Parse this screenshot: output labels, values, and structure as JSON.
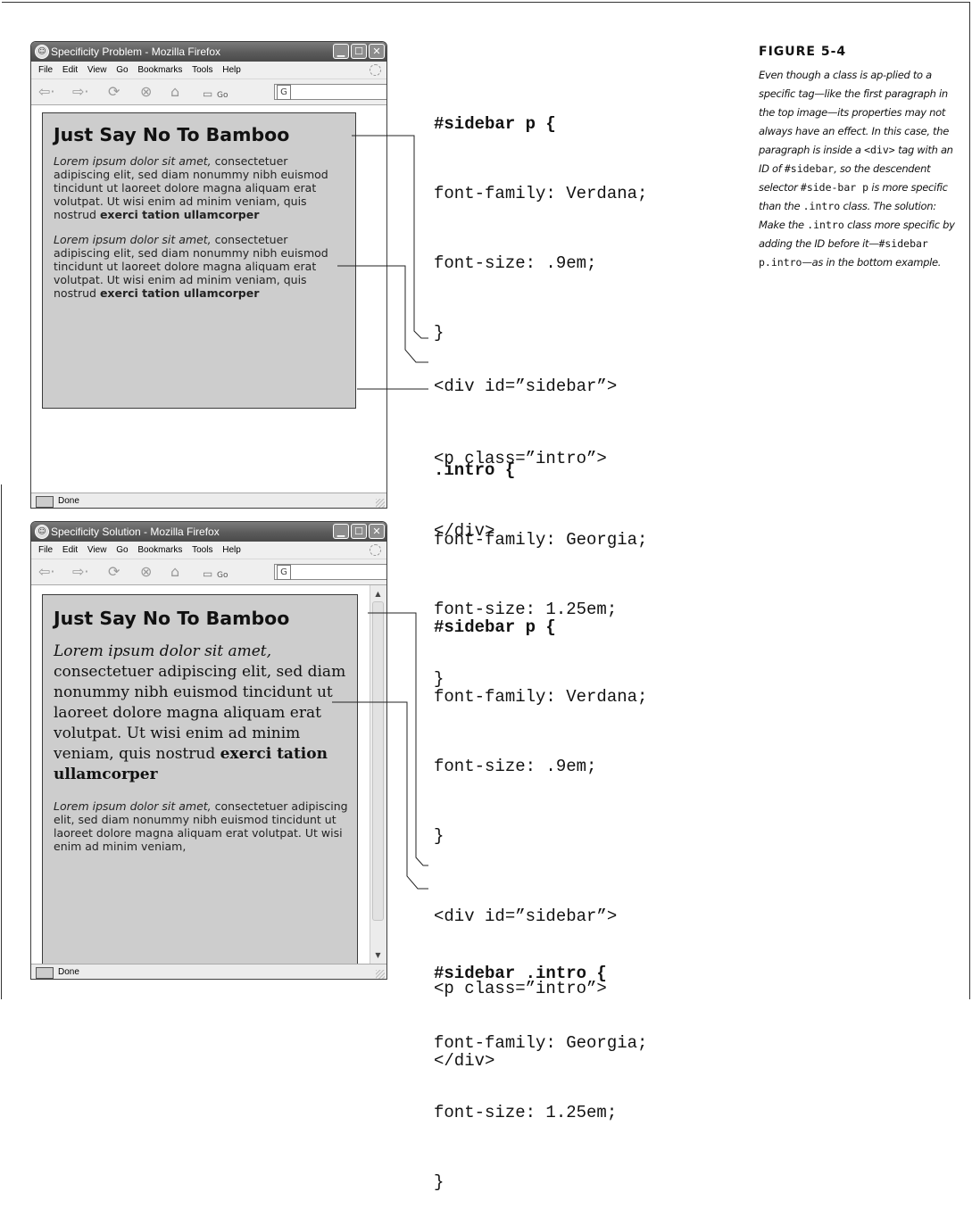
{
  "figure": {
    "label": "FIGURE 5-4",
    "caption": [
      {
        "t": "Even though a class is ap-plied to a specific tag—like the first paragraph in the top image—its properties may not always have an effect. In this case, the paragraph is inside a ",
        "code": false
      },
      {
        "t": "<div>",
        "code": true
      },
      {
        "t": " tag with an ID of ",
        "code": false
      },
      {
        "t": "#sidebar",
        "code": true
      },
      {
        "t": ", so the descendent selector ",
        "code": false
      },
      {
        "t": "#side-bar p",
        "code": true
      },
      {
        "t": " is more specific than the ",
        "code": false
      },
      {
        "t": ".intro",
        "code": true
      },
      {
        "t": " class. The solution: Make the ",
        "code": false
      },
      {
        "t": ".intro",
        "code": true
      },
      {
        "t": " class more specific by adding the ID before it—",
        "code": false
      },
      {
        "t": "#sidebar p.intro",
        "code": true
      },
      {
        "t": "—as in the bottom example.",
        "code": false
      }
    ]
  },
  "browser": {
    "menu": [
      "File",
      "Edit",
      "View",
      "Go",
      "Bookmarks",
      "Tools",
      "Help"
    ],
    "go_label": "Go",
    "url_icon": "G",
    "status": "Done",
    "heading": "Just Say No To Bamboo",
    "para_italic": "Lorem ipsum dolor sit amet,",
    "para_body": "consectetuer adipiscing elit, sed diam nonummy nibh euismod tincidunt ut laoreet dolore magna aliquam erat volutpat. Ut wisi enim ad minim veniam, quis nostrud ",
    "para_bold": "exerci tation ullamcorper",
    "para2_clipped": "consectetuer adipiscing elit, sed diam nonummy nibh euismod tincidunt ut laoreet dolore magna aliquam erat volutpat. Ut wisi enim ad minim veniam,"
  },
  "top": {
    "title": "Specificity Problem - Mozilla Firefox",
    "code_rule1": [
      "#sidebar p {",
      "font-family: Verdana;",
      "font-size: .9em;",
      "}"
    ],
    "code_rule2": [
      ".intro {",
      "font-family: Georgia;",
      "font-size: 1.25em;",
      "}"
    ],
    "html": [
      "<div id=”sidebar”>",
      "<p class=”intro”>",
      "</div>"
    ]
  },
  "bottom": {
    "title": "Specificity Solution - Mozilla Firefox",
    "code_rule1": [
      "#sidebar p {",
      "font-family: Verdana;",
      "font-size: .9em;",
      "}"
    ],
    "code_rule2": [
      "#sidebar .intro {",
      "font-family: Georgia;",
      "font-size: 1.25em;",
      "}"
    ],
    "html": [
      "<div id=”sidebar”>",
      "<p class=”intro”>",
      "</div>"
    ]
  },
  "icons": [
    "firefox-icon",
    "minimize-icon",
    "maximize-icon",
    "close-icon",
    "back-icon",
    "forward-icon",
    "reload-icon",
    "stop-icon",
    "home-icon",
    "throbber-icon",
    "status-icon",
    "resize-grip-icon",
    "scroll-up-icon",
    "scroll-down-icon"
  ]
}
